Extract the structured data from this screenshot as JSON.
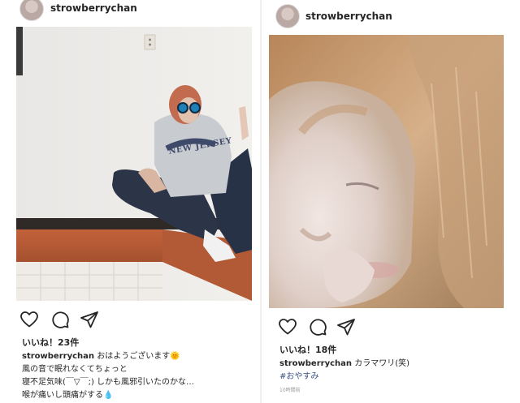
{
  "posts": [
    {
      "username": "strowberrychan",
      "likes": "いいね！23件",
      "caption_user": "strowberrychan",
      "caption_lines": [
        " おはようございます🌞",
        "風の音で眠れなくてちょっと",
        "寝不足気味(￣▽￣;) しかも風邪引いたのかな…",
        "喉が痛いし頭痛がする💧"
      ],
      "photo_text": "NEW JERSEY"
    },
    {
      "username": "strowberrychan",
      "likes": "いいね！18件",
      "caption_user": "strowberrychan",
      "caption_text": " カラマワリ(笑)",
      "hashtag": "#おやすみ",
      "timestamp": "10時間前"
    }
  ],
  "icons": [
    "heart-icon",
    "comment-icon",
    "share-icon"
  ],
  "colors": {
    "text": "#262626",
    "hashtag": "#385185",
    "timestamp": "#999999"
  }
}
